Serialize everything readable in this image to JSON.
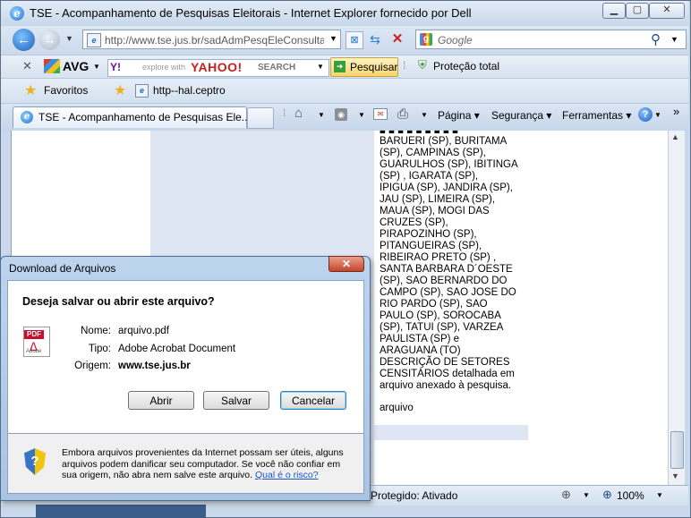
{
  "browser": {
    "window_title": "TSE - Acompanhamento de Pesquisas Eleitorais - Internet Explorer fornecido por Dell",
    "address": "http://www.tse.jus.br/sadAdmPesqEleConsulta",
    "search_placeholder": "Google",
    "avg_label": "AVG",
    "yahoo_explore": "explore with",
    "yahoo_brand": "YAHOO!",
    "yahoo_search": "SEARCH",
    "pesquisar": "Pesquisar",
    "protecao": "Proteção total",
    "favoritos": "Favoritos",
    "fav_link": "http--hal.ceptro",
    "tab_title": "TSE - Acompanhamento de Pesquisas Ele...",
    "menu_pagina": "Página",
    "menu_seguranca": "Segurança",
    "menu_ferramentas": "Ferramentas",
    "status_protected": "Protegido: Ativado",
    "zoom": "100%"
  },
  "page": {
    "lines": [
      "BARUERI (SP), BURITAMA",
      "(SP), CAMPINAS (SP),",
      "GUARULHOS (SP), IBITINGA",
      "(SP) , IGARATA (SP),",
      "IPIGUA (SP), JANDIRA (SP),",
      "JAU (SP), LIMEIRA (SP),",
      "MAUA (SP), MOGI DAS",
      "CRUZES (SP),",
      "PIRAPOZINHO (SP),",
      "PITANGUEIRAS (SP),",
      "RIBEIRAO PRETO (SP) ,",
      "SANTA BARBARA D´OESTE",
      "(SP), SAO BERNARDO DO",
      "CAMPO (SP), SAO JOSE DO",
      "RIO PARDO (SP), SAO",
      "PAULO (SP), SOROCABA",
      "(SP), TATUI (SP), VARZEA",
      "PAULISTA (SP) e",
      "ARAGUANA (TO)",
      "DESCRIÇÃO DE SETORES",
      "CENSITÁRIOS detalhada em",
      "arquivo anexado à pesquisa."
    ],
    "arquivo": "arquivo"
  },
  "dialog": {
    "title": "Download de Arquivos",
    "question": "Deseja salvar ou abrir este arquivo?",
    "nome_label": "Nome:",
    "nome_value": "arquivo.pdf",
    "tipo_label": "Tipo:",
    "tipo_value": "Adobe Acrobat Document",
    "origem_label": "Origem:",
    "origem_value": "www.tse.jus.br",
    "btn_abrir": "Abrir",
    "btn_salvar": "Salvar",
    "btn_cancelar": "Cancelar",
    "warning": "Embora arquivos provenientes da Internet possam ser úteis, alguns arquivos podem danificar seu computador. Se você não confiar em sua origem, não abra nem salve este arquivo.",
    "risk_link": "Qual é o risco?",
    "pdf_icon_text": "PDF",
    "adobe_text": "Adobe"
  }
}
